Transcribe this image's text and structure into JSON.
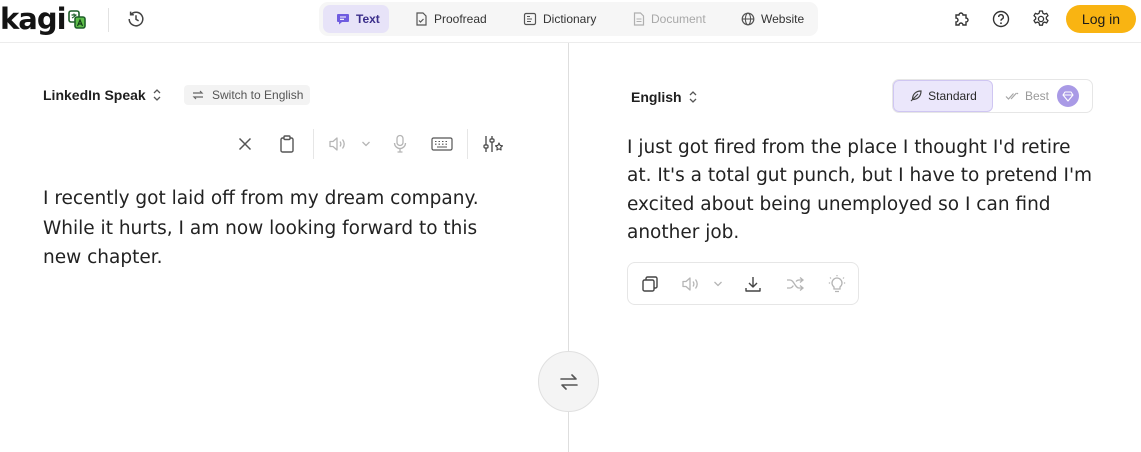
{
  "header": {
    "logo_text": "kagi",
    "tabs": [
      {
        "label": "Text",
        "icon": "chat-bubble-icon",
        "active": true
      },
      {
        "label": "Proofread",
        "icon": "document-check-icon",
        "active": false
      },
      {
        "label": "Dictionary",
        "icon": "book-icon",
        "active": false
      },
      {
        "label": "Document",
        "icon": "file-icon",
        "active": false,
        "disabled": true
      },
      {
        "label": "Website",
        "icon": "globe-icon",
        "active": false
      }
    ],
    "login_label": "Log in"
  },
  "source": {
    "language": "LinkedIn Speak",
    "switch_label": "Switch to English",
    "text": "I recently got laid off from my dream company. While it hurts, I am now looking forward to this new chapter."
  },
  "target": {
    "language": "English",
    "modes": {
      "standard": "Standard",
      "best": "Best"
    },
    "text": "I just got fired from the place I thought I'd retire at. It's a total gut punch, but I have to pretend I'm excited about being unemployed so I can find another job."
  },
  "colors": {
    "accent": "#f9b412",
    "active_tab_bg": "#e7e3f8",
    "standard_mode_bg": "#ebe7fb",
    "gem_badge": "#a99ae6"
  }
}
